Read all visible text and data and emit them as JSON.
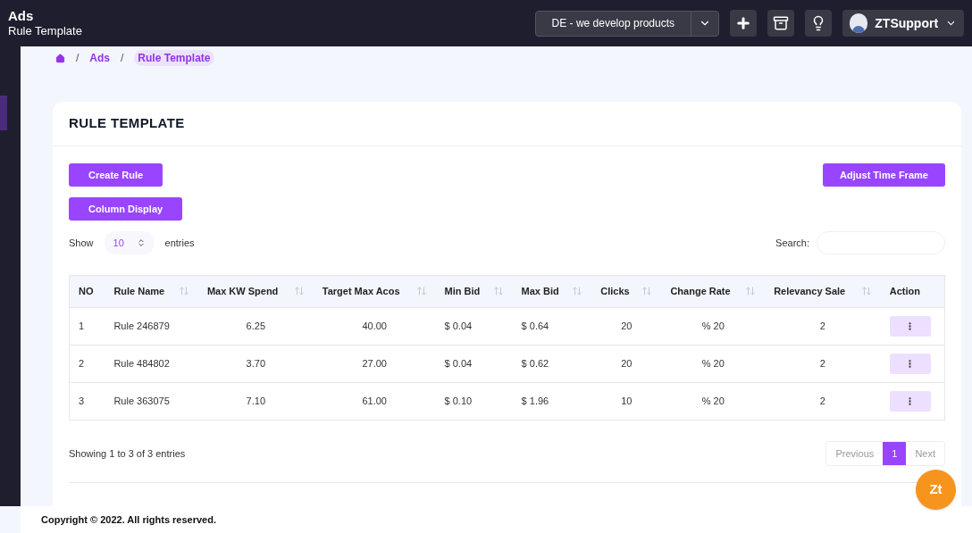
{
  "header": {
    "title": "Ads",
    "subtitle": "Rule Template",
    "store_select": "DE - we develop products",
    "user": "ZTSupport"
  },
  "breadcrumb": [
    "Ads",
    "Rule Template"
  ],
  "breadcrumb_separator": "/",
  "card": {
    "title": "RULE TEMPLATE",
    "buttons": [
      "Create Rule",
      "Column Display"
    ],
    "adjust_button": "Adjust Time Frame",
    "show_label": "Show",
    "entries_value": "10",
    "entries_label": "entries",
    "search_label": "Search:"
  },
  "table": {
    "columns": [
      {
        "label": "NO",
        "sortable": false
      },
      {
        "label": "Rule Name",
        "sortable": true
      },
      {
        "label": "Max KW Spend",
        "sortable": true
      },
      {
        "label": "Target Max Acos",
        "sortable": true
      },
      {
        "label": "Min Bid",
        "sortable": true
      },
      {
        "label": "Max Bid",
        "sortable": true
      },
      {
        "label": "Clicks",
        "sortable": true
      },
      {
        "label": "Change Rate",
        "sortable": true
      },
      {
        "label": "Relevancy Sale",
        "sortable": true
      },
      {
        "label": "Action",
        "sortable": false
      }
    ],
    "rows": [
      [
        "1",
        "Rule 246879",
        "6.25",
        "40.00",
        "$ 0.04",
        "$ 0.64",
        "20",
        "% 20",
        "2"
      ],
      [
        "2",
        "Rule 484802",
        "3.70",
        "27.00",
        "$ 0.04",
        "$ 0.62",
        "20",
        "% 20",
        "2"
      ],
      [
        "3",
        "Rule 363075",
        "7.10",
        "61.00",
        "$ 0.10",
        "$ 1.96",
        "10",
        "% 20",
        "2"
      ]
    ]
  },
  "info": "Showing 1 to 3 of 3 entries",
  "pagination": [
    {
      "label": "Previous",
      "selected": false
    },
    {
      "label": "1",
      "selected": true
    },
    {
      "label": "Next",
      "selected": false
    }
  ],
  "chat_badge": "Zt",
  "footer": "Copyright © 2022. All rights reserved."
}
